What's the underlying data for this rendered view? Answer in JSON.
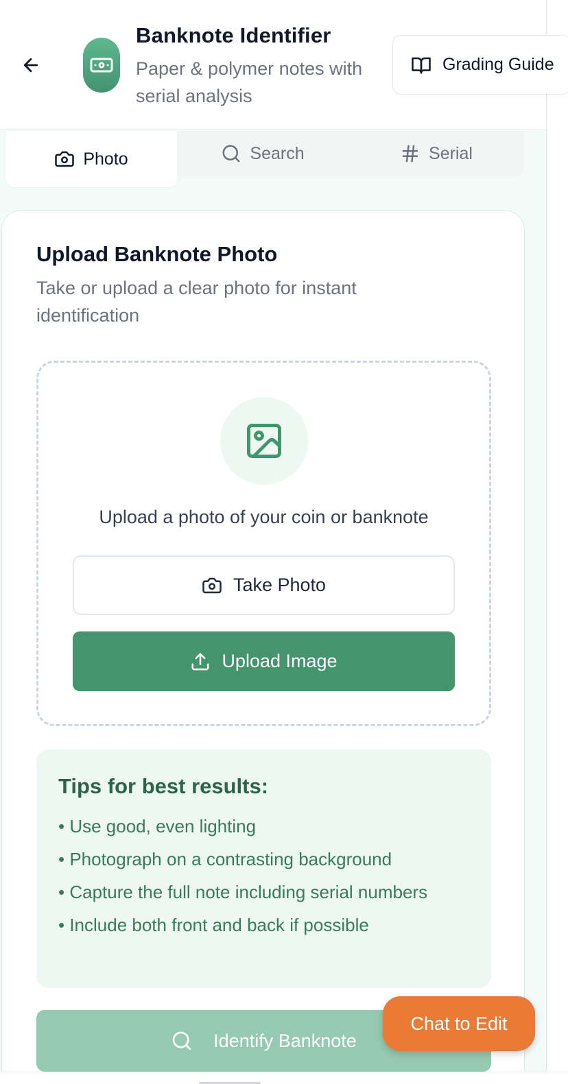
{
  "header": {
    "title": "Banknote Identifier",
    "subtitle": "Paper & polymer notes with serial analysis",
    "back_icon": "arrow-left-icon",
    "app_icon": "banknote-icon",
    "guide_button": {
      "label": "Grading Guide",
      "icon": "book-open-icon"
    }
  },
  "tabs": [
    {
      "label": "Photo",
      "icon": "camera-icon",
      "active": true
    },
    {
      "label": "Search",
      "icon": "search-icon",
      "active": false
    },
    {
      "label": "Serial",
      "icon": "hash-icon",
      "active": false
    }
  ],
  "upload_card": {
    "title": "Upload Banknote Photo",
    "description": "Take or upload a clear photo for instant identification",
    "dropzone": {
      "icon": "image-icon",
      "prompt": "Upload a photo of your coin or banknote",
      "take_photo_label": "Take Photo",
      "upload_label": "Upload Image"
    },
    "tips": {
      "title": "Tips for best results:",
      "items": [
        "• Use good, even lighting",
        "• Photograph on a contrasting background",
        "• Capture the full note including serial numbers",
        "• Include both front and back if possible"
      ]
    },
    "identify_label": "Identify Banknote"
  },
  "chat_button": {
    "label": "Chat to Edit"
  },
  "colors": {
    "accent": "#44956d",
    "accent_light": "#ecf8f1",
    "identify_disabled": "#96c9b1",
    "chat": "#e97b36"
  }
}
